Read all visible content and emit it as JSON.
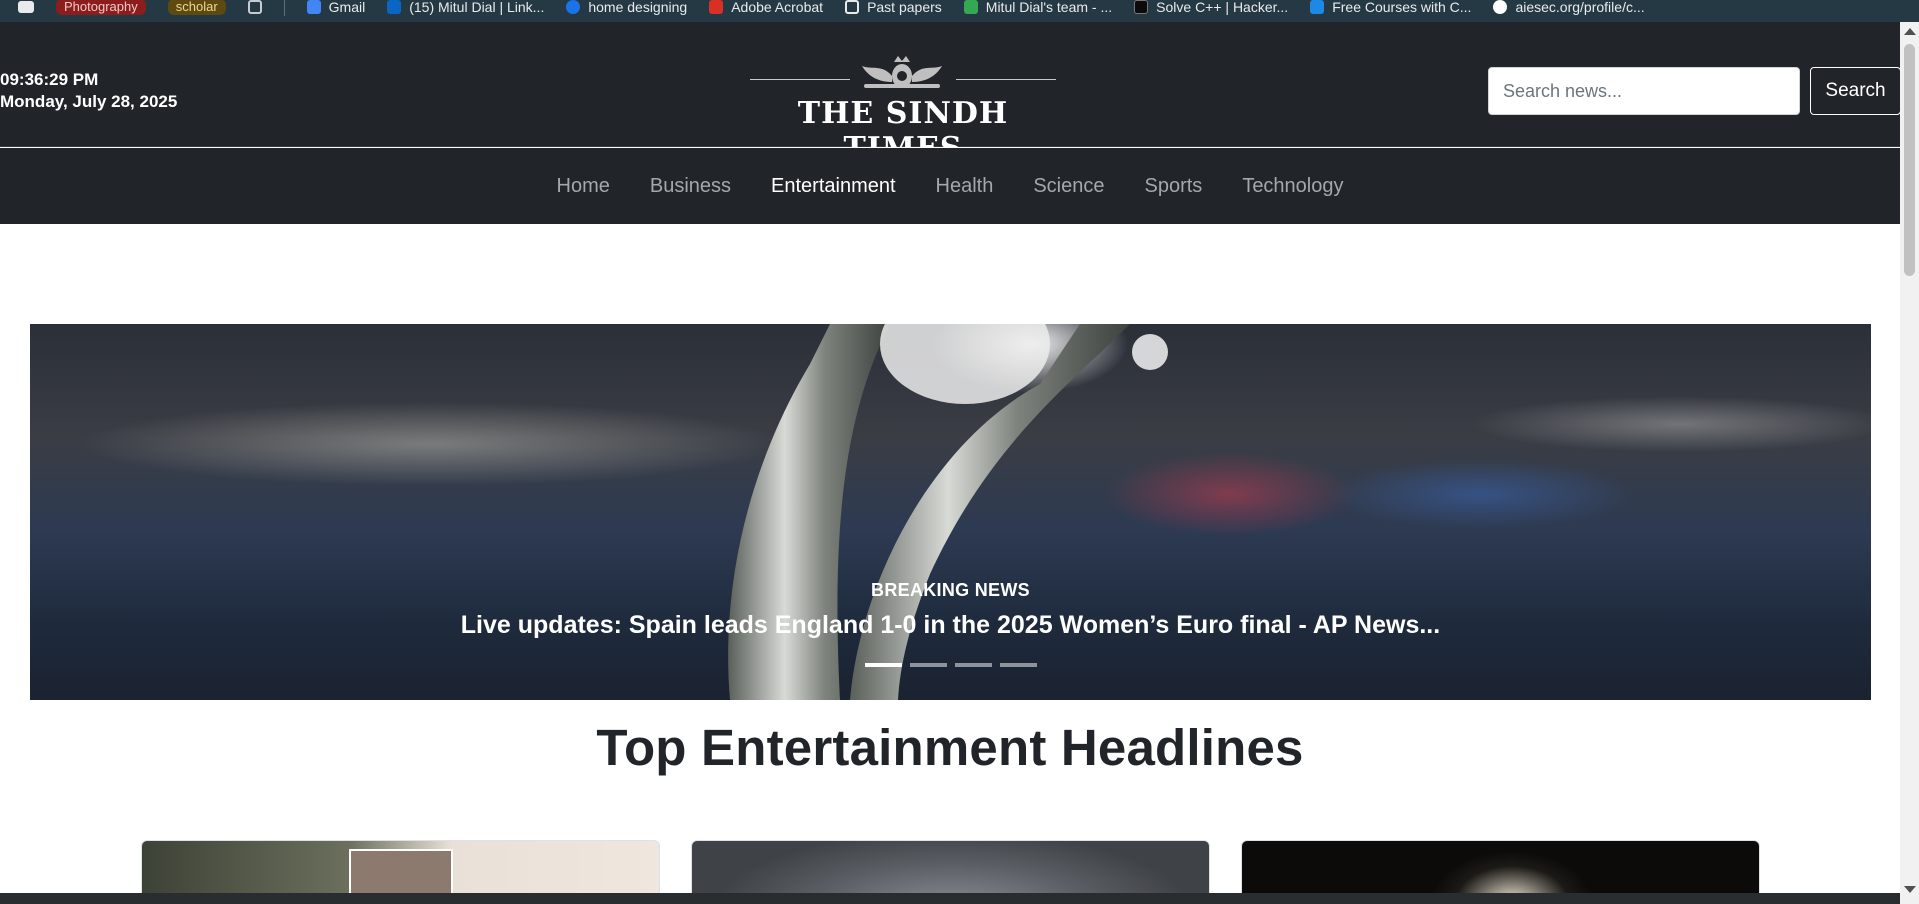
{
  "bookmarks": [
    {
      "label": "Photography",
      "kind": "tag",
      "color": "#8b1d1d"
    },
    {
      "label": "scholar",
      "kind": "tag",
      "color": "#5c4a12"
    },
    {
      "label": "Gmail",
      "kind": "link",
      "icon": "gmail-icon"
    },
    {
      "label": "(15) Mitul Dial | Link...",
      "kind": "link",
      "icon": "linkedin-icon"
    },
    {
      "label": "home designing",
      "kind": "link",
      "icon": "globe-icon"
    },
    {
      "label": "Adobe Acrobat",
      "kind": "link",
      "icon": "acrobat-icon"
    },
    {
      "label": "Past papers",
      "kind": "link",
      "icon": "folder-icon"
    },
    {
      "label": "Mitul Dial's team - ...",
      "kind": "link",
      "icon": "team-icon"
    },
    {
      "label": "Solve C++ | Hacker...",
      "kind": "link",
      "icon": "hackerrank-icon"
    },
    {
      "label": "Free Courses with C...",
      "kind": "link",
      "icon": "courses-icon"
    },
    {
      "label": "aiesec.org/profile/c...",
      "kind": "link",
      "icon": "aiesec-icon"
    }
  ],
  "header": {
    "time": "09:36:29 PM",
    "date": "Monday, July 28, 2025",
    "brand": "THE SINDH TIMES",
    "search_placeholder": "Search news...",
    "search_button": "Search"
  },
  "nav": {
    "items": [
      {
        "label": "Home",
        "active": false
      },
      {
        "label": "Business",
        "active": false
      },
      {
        "label": "Entertainment",
        "active": true
      },
      {
        "label": "Health",
        "active": false
      },
      {
        "label": "Science",
        "active": false
      },
      {
        "label": "Sports",
        "active": false
      },
      {
        "label": "Technology",
        "active": false
      }
    ]
  },
  "hero": {
    "kicker": "BREAKING NEWS",
    "title": "Live updates: Spain leads England 1-0 in the 2025 Women’s Euro final - AP News...",
    "slide_count": 4,
    "active_slide": 0
  },
  "section": {
    "title": "Top Entertainment Headlines"
  },
  "colors": {
    "header_bg": "#212529",
    "nav_text": "#a3a8ad",
    "nav_active": "#ffffff"
  }
}
